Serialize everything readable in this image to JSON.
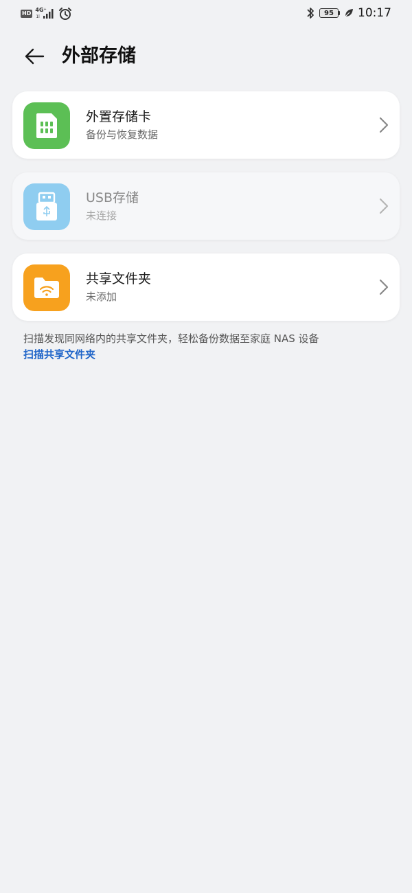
{
  "status_bar": {
    "hd": "HD",
    "network": "4G⁺",
    "network_sub": "1l",
    "battery": "95",
    "time": "10:17"
  },
  "header": {
    "title": "外部存储"
  },
  "items": [
    {
      "title": "外置存储卡",
      "subtitle": "备份与恢复数据",
      "icon": "sd-card-icon",
      "color": "#5cbf55",
      "enabled": true
    },
    {
      "title": "USB存储",
      "subtitle": "未连接",
      "icon": "usb-icon",
      "color": "#8fcdf0",
      "enabled": false
    },
    {
      "title": "共享文件夹",
      "subtitle": "未添加",
      "icon": "shared-folder-icon",
      "color": "#f7a11e",
      "enabled": true
    }
  ],
  "footer": {
    "info": "扫描发现同网络内的共享文件夹，轻松备份数据至家庭 NAS 设备",
    "link": "扫描共享文件夹"
  },
  "colors": {
    "background": "#f1f2f4",
    "link": "#1e64c8"
  }
}
